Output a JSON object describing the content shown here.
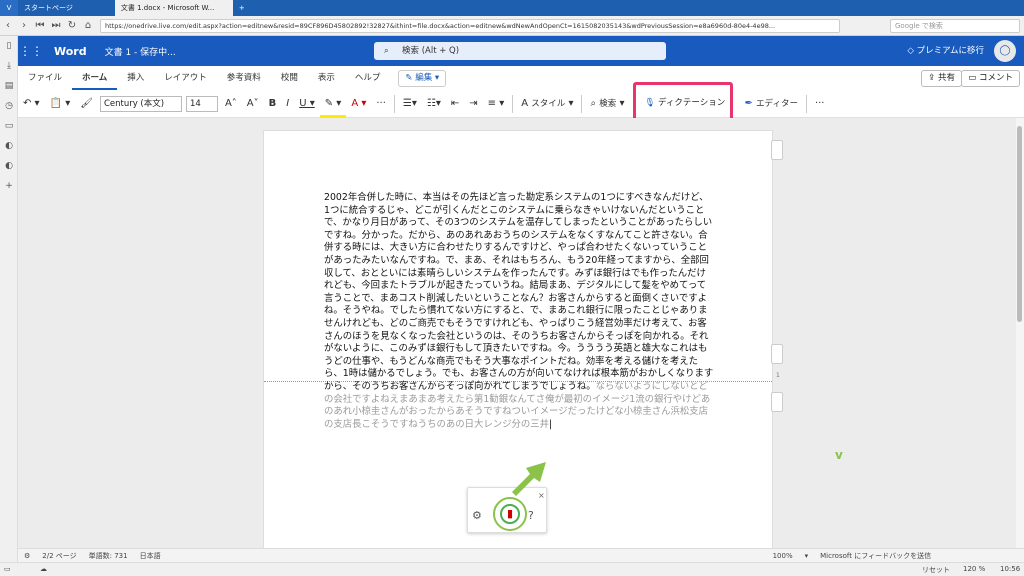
{
  "browser": {
    "tabs": [
      {
        "label": "スタートページ"
      },
      {
        "label": "文書 1.docx - Microsoft W..."
      }
    ],
    "url": "https://onedrive.live.com/edit.aspx?action=editnew&resid=89CF896D45802892!32827&ithint=file.docx&action=editnew&wdNewAndOpenCt=1615082035143&wdPreviousSession=e8a6960d-80e4-4e98...",
    "search_placeholder": "Google で検索"
  },
  "word": {
    "app_name": "Word",
    "doc_name": "文書 1 - 保存中...",
    "search_placeholder": "検索 (Alt + Q)",
    "premium": "プレミアムに移行"
  },
  "ribbon": {
    "tabs": [
      "ファイル",
      "ホーム",
      "挿入",
      "レイアウト",
      "参考資料",
      "校閲",
      "表示",
      "ヘルプ"
    ],
    "edit_mode": "編集",
    "share": "共有",
    "comment": "コメント"
  },
  "toolbar": {
    "font": "Century (本文)",
    "size": "14",
    "style": "スタイル",
    "find": "検索",
    "dictate": "ディクテーション",
    "editor": "エディター"
  },
  "document": {
    "text_main": "2002年合併した時に、本当はその先ほど言った勘定系システムの1つにすべきなんだけど、1つに統合するじゃ、どこが引くんだとこのシステムに乗らなきゃいけないんだということで、かなり月日があって、その3つのシステムを温存してしまったということがあったらしいですね。分かった。だから、あのあれあおうちのシステムをなくすなんてこと許さない。合併する時には、大きい方に合わせたりするんですけど、やっぱ合わせたくないっていうことがあったみたいなんですね。で、まあ、それはもちろん、もう20年経ってますから、全部回収して、おとといには素晴らしいシステムを作ったんです。みずほ銀行はでも作ったんだけれども、今回またトラブルが起きたっていうね。結局まあ、デジタルにして髪をやめてって言うことで、まあコスト削減したいということなん？お客さんからすると面倒くさいですよね。そうやね。でしたら慣れてない方にすると、で、まあこれ銀行に限ったことじゃありませんけれども、どのご商売でもそうですけれども、やっぱりこう経営効率だけ考えて、お客さんのほうを見なくなった会社というのは、そのうちお客さんからそっぽを向かれる。それがないように、このみずほ銀行もして頂きたいですね。今。うううう英語と雄大なこれはもうどの仕事や、もうどんな商売でもそう大事なポイントだね。効率を考える儲けを考えたら、1時は儲かるでしょう。でも、お客さんの方が向いてなければ根本筋がおかしくなりますから、そのうちお客さんからそっぽ向かれてしまうでしょうね。",
    "text_dim": "ならないようにしないとどの会社ですよねえまあまあ考えたら第1勧銀なんてさ俺が最初のイメージ1流の銀行やけどあのあれ小椋圭さんがおったからあそうですねついイメージだったけどな小椋圭さん浜松支店の支店長こそうですねうちのあの日大レンジ分の三井",
    "page_num": "1"
  },
  "status": {
    "pages": "2/2 ページ",
    "words": "単語数: 731",
    "lang": "日本語",
    "zoom": "100%",
    "feedback": "Microsoft にフィードバックを送信"
  },
  "taskbar": {
    "reset": "リセット",
    "zoom": "120 %",
    "time": "10:56"
  }
}
